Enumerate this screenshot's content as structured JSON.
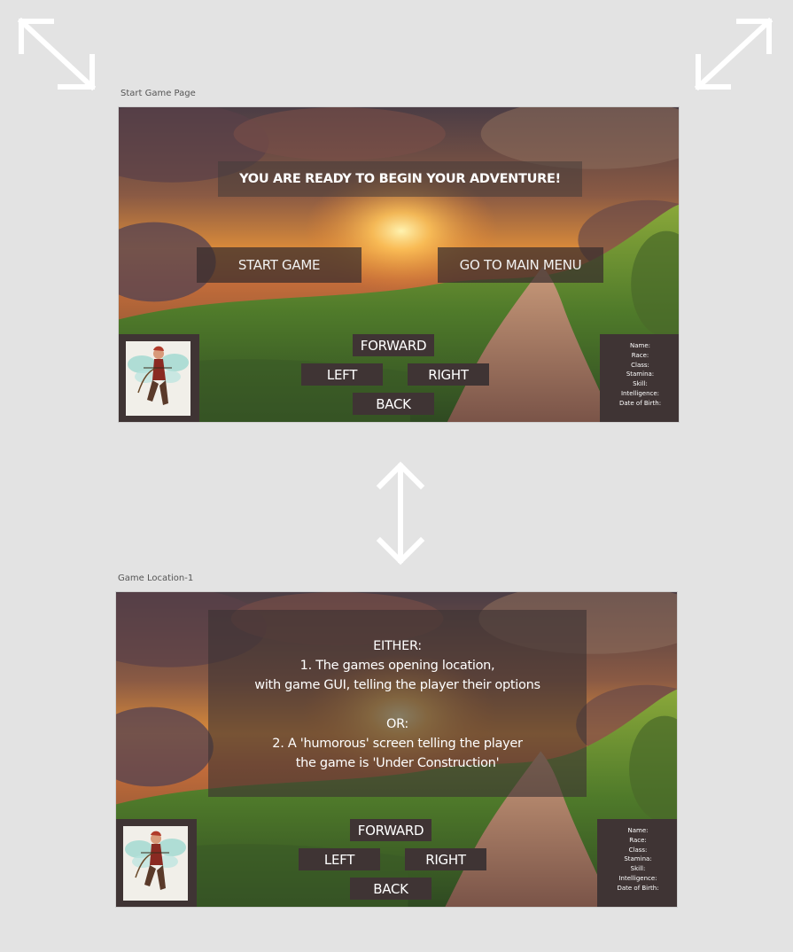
{
  "frames": [
    {
      "label": "Start Game Page",
      "banner": "YOU ARE READY TO BEGIN YOUR ADVENTURE!",
      "start_game": "START GAME",
      "main_menu": "GO TO MAIN MENU",
      "nav": {
        "forward": "FORWARD",
        "left": "LEFT",
        "right": "RIGHT",
        "back": "BACK"
      },
      "stats": [
        "Name:",
        "Race:",
        "Class:",
        "Stamina:",
        "Skill:",
        "Intelligence:",
        "Date of Birth:"
      ]
    },
    {
      "label": "Game Location-1",
      "info_lines": [
        "EITHER:",
        "1. The games opening location,",
        "with game GUI, telling the player their options",
        "",
        "OR:",
        "2. A 'humorous' screen telling the player",
        "the game is 'Under Construction'"
      ],
      "nav": {
        "forward": "FORWARD",
        "left": "LEFT",
        "right": "RIGHT",
        "back": "BACK"
      },
      "stats": [
        "Name:",
        "Race:",
        "Class:",
        "Stamina:",
        "Skill:",
        "Intelligence:",
        "Date of Birth:"
      ]
    }
  ],
  "icons": {
    "top_left": "expand-diagonal-arrow-icon",
    "top_right": "expand-diagonal-arrow-icon",
    "center": "vertical-double-arrow-icon",
    "portrait": "fairy-archer-portrait"
  }
}
